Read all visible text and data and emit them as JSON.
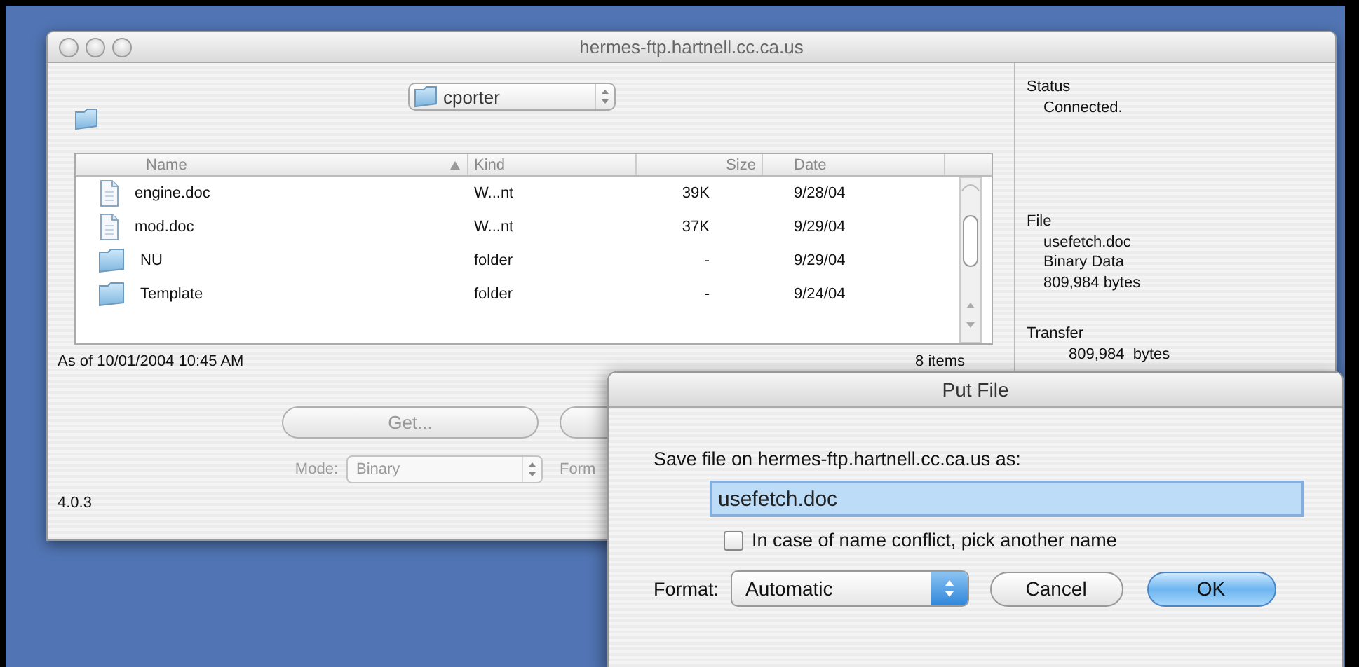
{
  "window": {
    "title": "hermes-ftp.hartnell.cc.ca.us",
    "folder_popup": "cporter",
    "table": {
      "columns": [
        {
          "label": "Name",
          "sorted": true
        },
        {
          "label": "Kind",
          "sorted": false
        },
        {
          "label": "Size",
          "sorted": false
        },
        {
          "label": "Date",
          "sorted": false
        }
      ],
      "rows": [
        {
          "kind": "document",
          "name": "engine.doc",
          "kind_label": "W...nt",
          "size": "39K",
          "date": "9/28/04"
        },
        {
          "kind": "document",
          "name": "mod.doc",
          "kind_label": "W...nt",
          "size": "37K",
          "date": "9/29/04"
        },
        {
          "kind": "folder",
          "name": "NU",
          "kind_label": "folder",
          "size": "-",
          "date": "9/29/04"
        },
        {
          "kind": "folder",
          "name": "Template",
          "kind_label": "folder",
          "size": "-",
          "date": "9/24/04"
        }
      ]
    },
    "as_of": "As of 10/01/2004 10:45 AM",
    "item_count": "8 items",
    "get_button": {
      "label": "Get...",
      "disabled": true
    },
    "mode": {
      "label": "Mode:",
      "value": "Binary",
      "disabled": true
    },
    "format_label": "Form",
    "version": "4.0.3",
    "info": [
      {
        "heading": "Status",
        "lines": [
          "Connected."
        ]
      },
      {
        "heading": "File",
        "lines": [
          "usefetch.doc",
          "Binary Data",
          "809,984 bytes"
        ]
      },
      {
        "heading": "Transfer",
        "lines": [
          "809,984  bytes"
        ]
      }
    ]
  },
  "dialog": {
    "title": "Put File",
    "prompt": "Save file on hermes-ftp.hartnell.cc.ca.us as:",
    "filename": "usefetch.doc",
    "checkbox": {
      "label": "In case of name conflict, pick another name",
      "checked": false
    },
    "format": {
      "label": "Format:",
      "value": "Automatic"
    },
    "buttons": [
      {
        "label": "Cancel",
        "default": false
      },
      {
        "label": "OK",
        "default": true
      }
    ]
  }
}
